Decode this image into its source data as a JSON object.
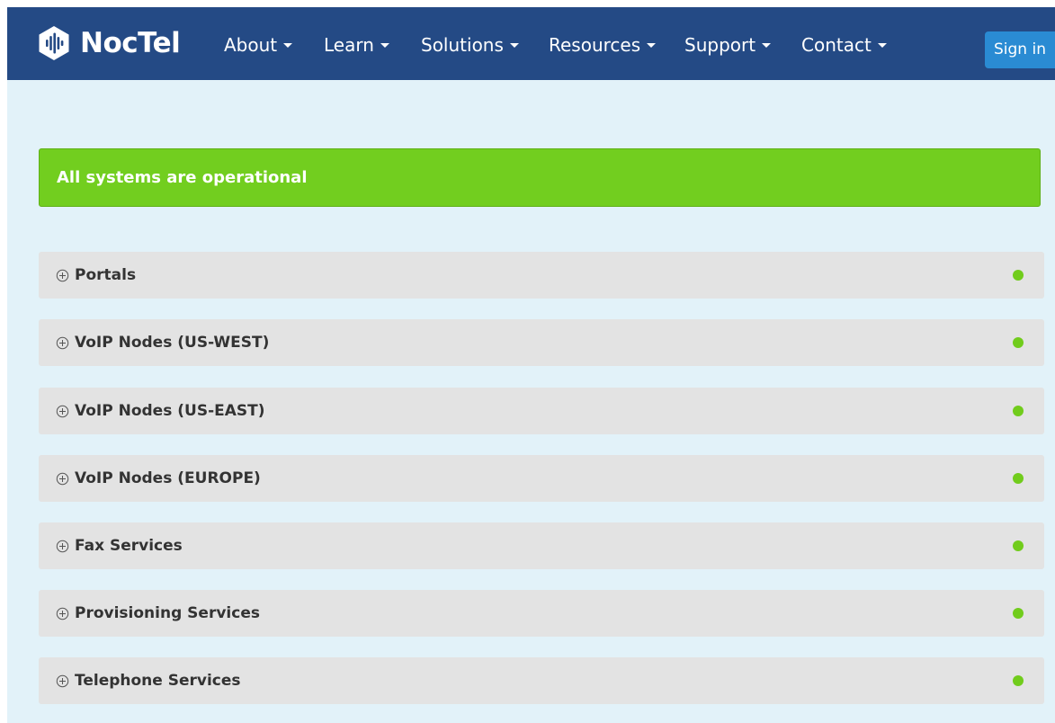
{
  "brand": {
    "name": "NocTel"
  },
  "nav": {
    "items": [
      {
        "label": "About"
      },
      {
        "label": "Learn"
      },
      {
        "label": "Solutions"
      },
      {
        "label": "Resources"
      },
      {
        "label": "Support"
      },
      {
        "label": "Contact"
      }
    ],
    "signin_label": "Sign in"
  },
  "status": {
    "message": "All systems are operational"
  },
  "services": [
    {
      "name": "Portals",
      "status": "operational"
    },
    {
      "name": "VoIP Nodes (US-WEST)",
      "status": "operational"
    },
    {
      "name": "VoIP Nodes (US-EAST)",
      "status": "operational"
    },
    {
      "name": "VoIP Nodes (EUROPE)",
      "status": "operational"
    },
    {
      "name": "Fax Services",
      "status": "operational"
    },
    {
      "name": "Provisioning Services",
      "status": "operational"
    },
    {
      "name": "Telephone Services",
      "status": "operational"
    }
  ],
  "icons": {
    "logo": "noctel-logo-icon",
    "expand": "circle-plus-icon",
    "dropdown": "caret-down-icon",
    "status": "status-dot-icon"
  },
  "colors": {
    "navbar": "#244a85",
    "page_background": "#e2f2f9",
    "banner": "#72ce1f",
    "row": "#e3e3e3",
    "status_ok": "#71cc1c",
    "signin": "#2a8bd3"
  }
}
